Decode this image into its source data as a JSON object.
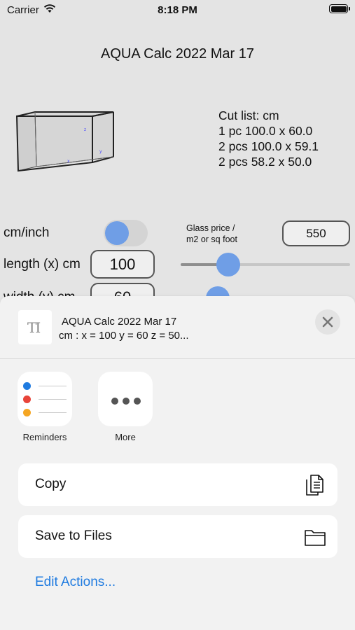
{
  "status_bar": {
    "carrier": "Carrier",
    "time": "8:18 PM"
  },
  "app": {
    "title": "AQUA Calc 2022 Mar 17",
    "cut_list": [
      "Cut list: cm",
      "1 pc 100.0 x 60.0",
      "2 pcs 100.0 x 59.1",
      "2 pcs 58.2 x 50.0"
    ],
    "unit_toggle": {
      "label": "cm/inch",
      "on": false
    },
    "glass_price": {
      "label_line1": "Glass price /",
      "label_line2": "m2 or sq foot",
      "value": "550"
    },
    "length": {
      "label": "length (x) cm",
      "value": "100",
      "slider_fraction": 0.28
    },
    "width": {
      "label": "width  (y) cm",
      "value": "60",
      "slider_fraction": 0.22
    },
    "accent_color": "#6f9ee6"
  },
  "share_sheet": {
    "preview_title": "AQUA Calc 2022 Mar 17",
    "preview_subtitle": "cm : x = 100 y = 60 z = 50...",
    "apps": [
      {
        "label": "Reminders",
        "icon": "reminders-icon"
      },
      {
        "label": "More",
        "icon": "more-icon"
      }
    ],
    "actions": [
      {
        "label": "Copy",
        "icon": "copy-icon"
      },
      {
        "label": "Save to Files",
        "icon": "folder-icon"
      }
    ],
    "edit_actions": "Edit Actions...",
    "link_color": "#1f7be0"
  }
}
